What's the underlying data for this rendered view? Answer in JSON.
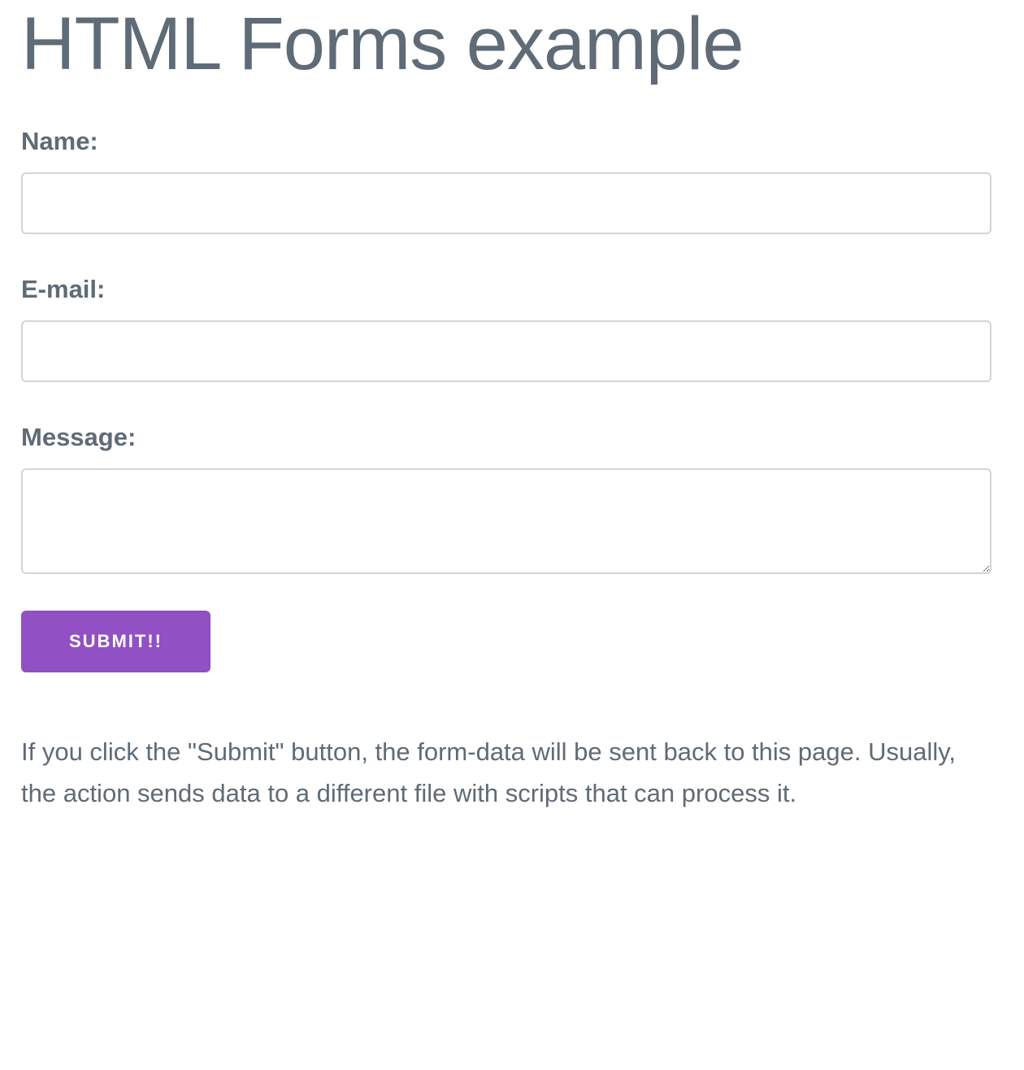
{
  "page": {
    "title": "HTML Forms example"
  },
  "form": {
    "name_label": "Name:",
    "name_value": "",
    "email_label": "E-mail:",
    "email_value": "",
    "message_label": "Message:",
    "message_value": "",
    "submit_label": "SUBMIT!!"
  },
  "note": {
    "text": "If you click the \"Submit\" button, the form-data will be sent back to this page. Usually, the action sends data to a different file with scripts that can process it."
  },
  "colors": {
    "accent": "#9150c3",
    "text": "#5f6b76",
    "input_border": "#d4d4d4"
  }
}
